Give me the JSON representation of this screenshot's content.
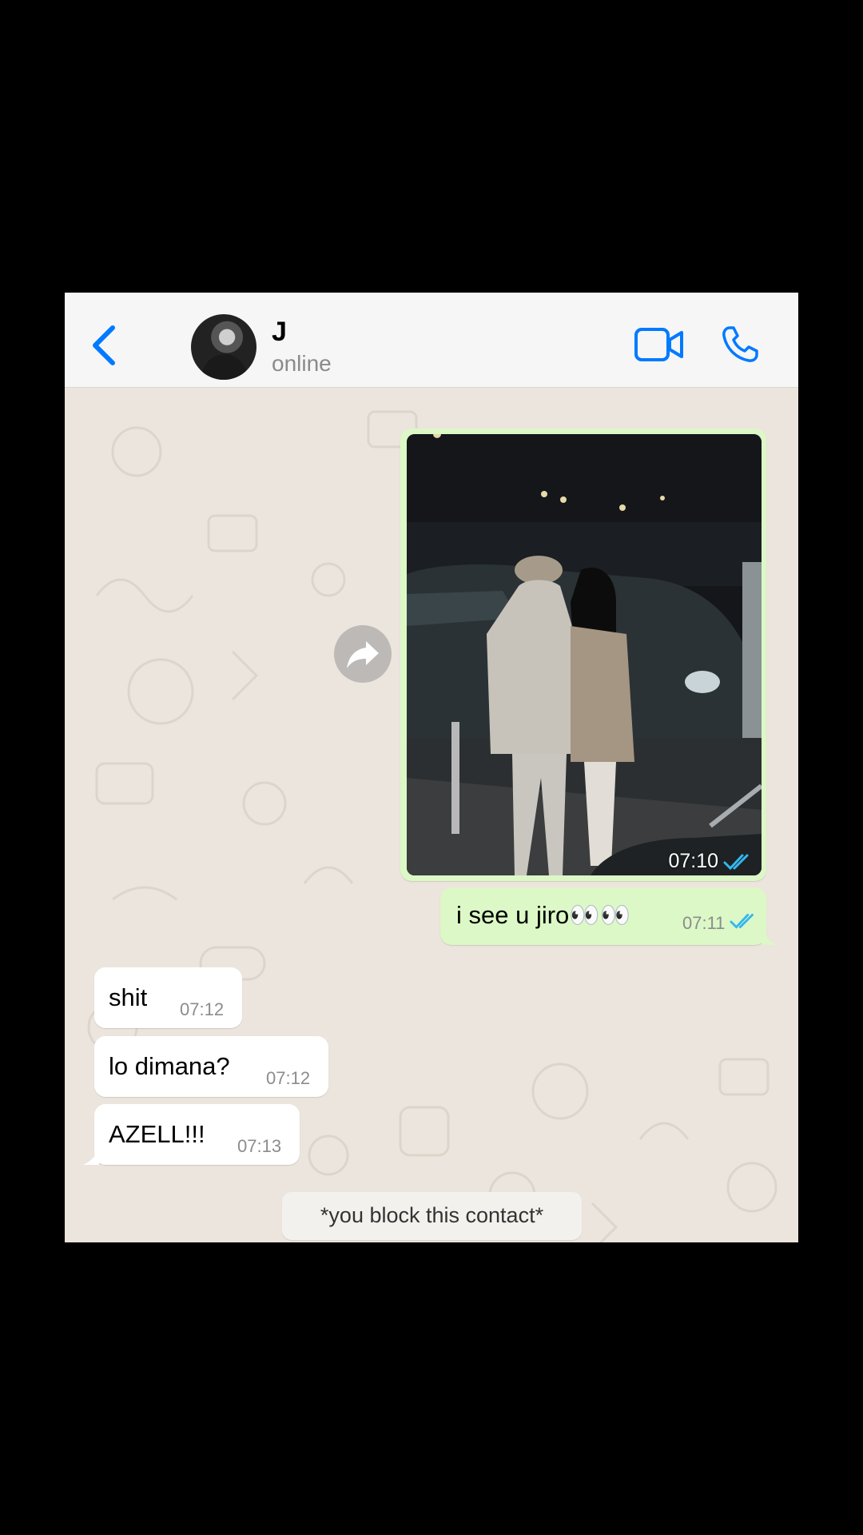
{
  "header": {
    "contact_name": "J",
    "contact_status": "online",
    "back_icon": "chevron-left-icon",
    "video_icon": "video-camera-icon",
    "call_icon": "phone-icon",
    "accent_color": "#007aff"
  },
  "messages": [
    {
      "type": "image",
      "direction": "outgoing",
      "time": "07:10",
      "status": "read"
    },
    {
      "type": "text",
      "direction": "outgoing",
      "text": "i see u jiro👀👀",
      "time": "07:11",
      "status": "read"
    },
    {
      "type": "text",
      "direction": "incoming",
      "text": "shit",
      "time": "07:12"
    },
    {
      "type": "text",
      "direction": "incoming",
      "text": "lo dimana?",
      "time": "07:12"
    },
    {
      "type": "text",
      "direction": "incoming",
      "text": "AZELL!!!",
      "time": "07:13"
    }
  ],
  "system_note": "*you block this contact*",
  "forward_icon": "forward-arrow-icon",
  "colors": {
    "outgoing_bubble": "#dcf8c6",
    "incoming_bubble": "#ffffff",
    "read_ticks": "#34b7f1",
    "wallpaper": "#ece5dd"
  }
}
